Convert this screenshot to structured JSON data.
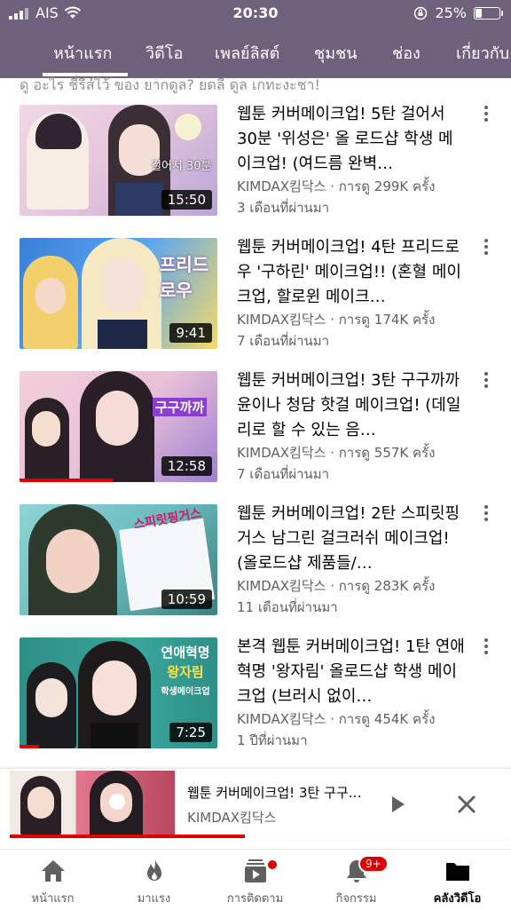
{
  "status_bar": {
    "carrier": "AIS",
    "time": "20:30",
    "battery": "25%",
    "battery_level": 0.25
  },
  "tabs": [
    {
      "label": "หน้าแรก",
      "active": true
    },
    {
      "label": "วิดีโอ"
    },
    {
      "label": "เพลย์ลิสต์"
    },
    {
      "label": "ชุมชน"
    },
    {
      "label": "ช่อง"
    },
    {
      "label": "เกี่ยวกับ"
    }
  ],
  "cut_off_text": "ดู อะไร ชี่รีส์ไว้ ของ ยากดูล? ยดลี ดูล เกทะงะชา!",
  "videos": [
    {
      "title": "웹툰 커버메이크업! 5탄 걸어서 30분 '위성은' 올 로드샵 학생 메이크업! (여드름 완벽…",
      "channel_views": "KIMDAX킴닥스 · การดู 299K ครั้ง",
      "age": "3 เดือนที่ผ่านมา",
      "duration": "15:50",
      "progress": 0,
      "thumb_text": "걸어서 30분",
      "colors": [
        "#f1d7e4",
        "#b9a6d6"
      ]
    },
    {
      "title": "웹툰 커버메이크업! 4탄 프리드로우 '구하린' 메이크업!! (혼혈 메이크업, 할로윈 메이크…",
      "channel_views": "KIMDAX킴닥스 · การดู 174K ครั้ง",
      "age": "7 เดือนที่ผ่านมา",
      "duration": "9:41",
      "progress": 0,
      "thumb_text": "프리드로우",
      "colors": [
        "#3a7ed8",
        "#f4d96a"
      ]
    },
    {
      "title": "웹툰 커버메이크업! 3탄 구구까까 윤이나 청담 핫걸 메이크업! (데일리로 할 수 있는 음…",
      "channel_views": "KIMDAX킴닥스 · การดู 557K ครั้ง",
      "age": "7 เดือนที่ผ่านมา",
      "duration": "12:58",
      "progress": 0.47,
      "thumb_text": "구구까까",
      "colors": [
        "#f3cfd9",
        "#9f7fd1"
      ]
    },
    {
      "title": "웹툰 커버메이크업! 2탄 스피릿핑거스 남그린 걸크러쉬 메이크업! (올로드샵 제품들/…",
      "channel_views": "KIMDAX킴닥스 · การดู 283K ครั้ง",
      "age": "11 เดือนที่ผ่านมา",
      "duration": "10:59",
      "progress": 0,
      "thumb_text": "스피릿핑거스",
      "colors": [
        "#8fd3d6",
        "#3f7f80"
      ]
    },
    {
      "title": "본격 웹툰 커버메이크업! 1탄 연애혁명 '왕자림' 올로드샵 학생 메이크업 (브러시 없이…",
      "channel_views": "KIMDAX킴닥스 · การดู 454K ครั้ง",
      "age": "1 ปีที่ผ่านมา",
      "duration": "7:25",
      "progress": 0.1,
      "thumb_text": "연애혁명",
      "thumb_text2": "왕자림",
      "thumb_text3": "학생메이크업",
      "colors": [
        "#2e8f86",
        "#f2f2f2"
      ]
    }
  ],
  "mini_player": {
    "title": "웹툰 커버메이크업! 3탄 구구…",
    "channel": "KIMDAX킴닥스",
    "progress": 0.47
  },
  "bottom_nav": [
    {
      "label": "หน้าแรก",
      "icon": "home-icon"
    },
    {
      "label": "มาแรง",
      "icon": "trending-icon"
    },
    {
      "label": "การติดตาม",
      "icon": "subscriptions-icon"
    },
    {
      "label": "กิจกรรม",
      "icon": "bell-icon",
      "badge": "9+"
    },
    {
      "label": "คลังวิดีโอ",
      "icon": "library-icon",
      "active": true
    }
  ]
}
